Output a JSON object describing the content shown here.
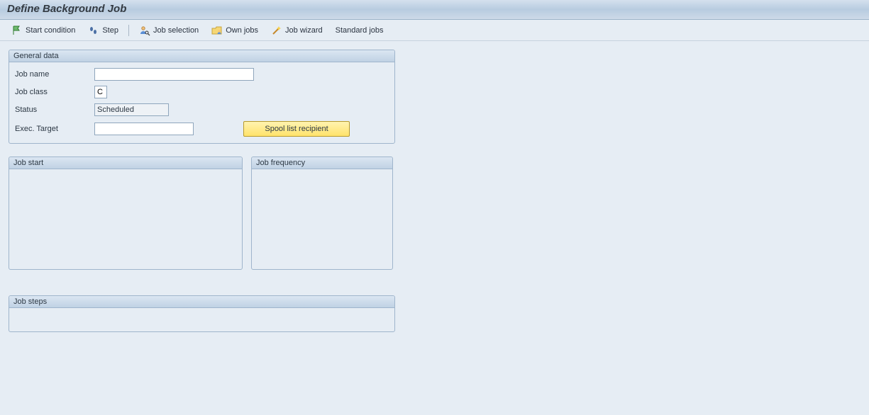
{
  "title": "Define Background Job",
  "toolbar": {
    "start_condition": "Start condition",
    "step": "Step",
    "job_selection": "Job selection",
    "own_jobs": "Own jobs",
    "job_wizard": "Job wizard",
    "standard_jobs": "Standard jobs"
  },
  "panels": {
    "general_data": "General data",
    "job_start": "Job start",
    "job_frequency": "Job frequency",
    "job_steps": "Job steps"
  },
  "fields": {
    "job_name_label": "Job name",
    "job_name_value": "",
    "job_class_label": "Job class",
    "job_class_value": "C",
    "status_label": "Status",
    "status_value": "Scheduled",
    "exec_target_label": "Exec. Target",
    "exec_target_value": "",
    "spool_button": "Spool list recipient"
  }
}
